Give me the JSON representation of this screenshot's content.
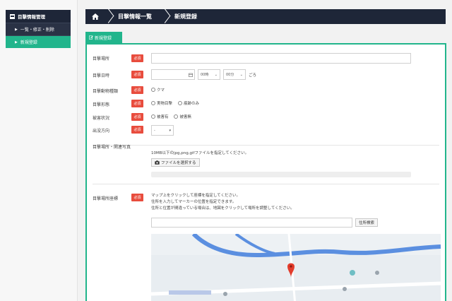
{
  "sidebar": {
    "section_title": "目撃情報管理",
    "items": [
      {
        "label": "一覧・修正・削除",
        "active": false
      },
      {
        "label": "新規登録",
        "active": true
      }
    ]
  },
  "breadcrumb": {
    "items": [
      "目撃情報一覧",
      "新規登録"
    ]
  },
  "tab": {
    "label": "新規登録"
  },
  "form": {
    "required_badge": "必須",
    "sighting_place": {
      "label": "目撃場所",
      "value": ""
    },
    "sighting_datetime": {
      "label": "目撃日時",
      "date_value": "",
      "hour": "00時",
      "minute": "00分",
      "suffix": "ごろ"
    },
    "animal_type": {
      "label": "目撃動物種類",
      "options": [
        "クマ"
      ]
    },
    "sighting_form": {
      "label": "目撃形態",
      "options": [
        "実物目撃",
        "痕跡のみ"
      ]
    },
    "damage": {
      "label": "被害状況",
      "options": [
        "被害有",
        "被害無"
      ]
    },
    "direction": {
      "label": "出没方向",
      "selected": "-"
    },
    "photo": {
      "label": "目撃場所・関連写真",
      "note": "10MB以下のjpg,png,gifファイルを指定してください。",
      "button": "ファイルを選択する"
    },
    "location": {
      "label": "目撃場所座標",
      "notes": [
        "マップ上をクリックして座標を指定してください。",
        "住所を入力してマーカーの位置を指定できます。",
        "住所と位置が間違っている場合は、地図をクリックして場所を調整してください。"
      ],
      "address_value": "",
      "search_button": "住所検索"
    }
  },
  "colors": {
    "accent": "#22b58c",
    "navy": "#1e2638",
    "required": "#e84c3d"
  }
}
